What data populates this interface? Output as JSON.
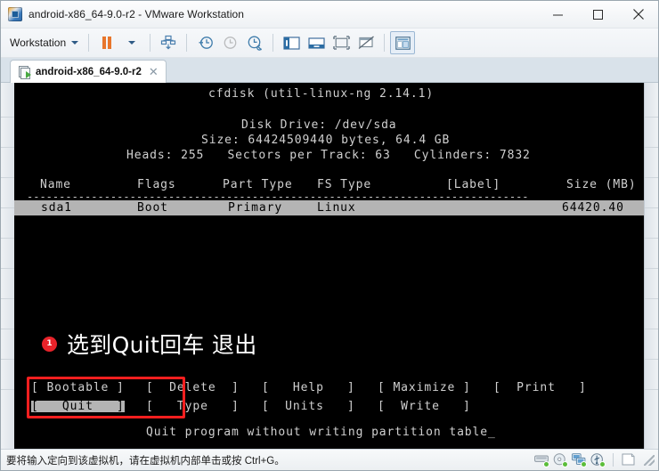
{
  "window": {
    "title": "android-x86_64-9.0-r2 - VMware Workstation",
    "app_icon": "vmware-logo-icon",
    "minimize_label": "—",
    "maximize_label": "☐",
    "close_label": "✕"
  },
  "toolbar": {
    "workstation_menu": "Workstation",
    "buttons": [
      {
        "name": "pause-vm-button",
        "icon": "pause-icon"
      },
      {
        "name": "power-dropdown-button",
        "icon": "chevron-down-icon"
      },
      {
        "name": "manage-snapshots-button",
        "icon": "snapshot-manager-icon"
      },
      {
        "name": "take-snapshot-button",
        "icon": "snapshot-add-icon"
      },
      {
        "name": "revert-snapshot-button",
        "icon": "snapshot-revert-icon"
      },
      {
        "name": "snapshot-manager-button",
        "icon": "snapshot-wrench-icon"
      },
      {
        "name": "show-library-button",
        "icon": "sidebar-panel-icon"
      },
      {
        "name": "show-thumbnail-bar-button",
        "icon": "thumbnail-bar-icon"
      },
      {
        "name": "full-screen-button",
        "icon": "fullscreen-icon"
      },
      {
        "name": "unity-mode-button",
        "icon": "unity-mode-icon"
      },
      {
        "name": "console-view-button",
        "icon": "console-view-icon"
      }
    ]
  },
  "tab": {
    "label": "android-x86_64-9.0-r2",
    "close_label": "✕",
    "icon": "vm-tab-icon"
  },
  "terminal": {
    "app_title": "cfdisk (util-linux-ng 2.14.1)",
    "disk_drive": "Disk Drive: /dev/sda",
    "size_line": "Size: 64424509440 bytes, 64.4 GB",
    "geometry_line": "Heads: 255   Sectors per Track: 63   Cylinders: 7832",
    "columns": {
      "name": "Name",
      "flags": "Flags",
      "part_type": "Part Type",
      "fs_type": "FS Type",
      "label": "[Label]",
      "size": "Size (MB)"
    },
    "divider": "------------------------------------------------------------------------------",
    "partition_row": {
      "name": "sda1",
      "flags": "Boot",
      "part_type": "Primary",
      "fs_type": "Linux",
      "label": "",
      "size": "64420.40"
    },
    "menu_row1": [
      "[ Bootable ]",
      "[  Delete  ]",
      "[   Help   ]",
      "[ Maximize ]",
      "[  Print   ]"
    ],
    "menu_row2": [
      "[   Quit   ]",
      "[   Type   ]",
      "[  Units   ]",
      "[  Write   ]"
    ],
    "selected_menu_item": "Quit",
    "help_line": "Quit program without writing partition table_"
  },
  "annotation": {
    "badge": "1",
    "text": "选到Quit回车 退出",
    "highlight_color": "#ff1f1f",
    "badge_color": "#e8232a"
  },
  "statusbar": {
    "message": "要将输入定向到该虚拟机，请在虚拟机内部单击或按 Ctrl+G。",
    "icons": [
      {
        "name": "status-harddisk-icon"
      },
      {
        "name": "status-cdrom-icon"
      },
      {
        "name": "status-network-icon"
      },
      {
        "name": "status-usb-icon"
      },
      {
        "name": "status-message-log-icon"
      }
    ]
  }
}
